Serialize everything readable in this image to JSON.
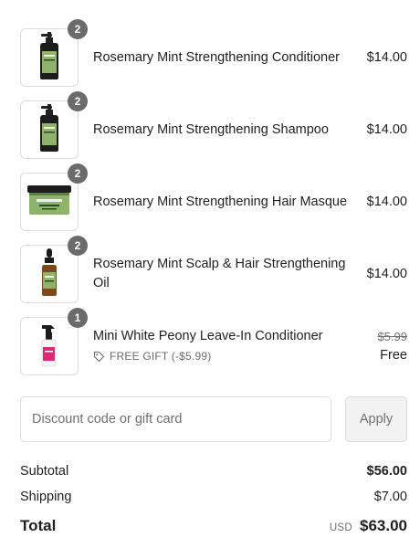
{
  "items": [
    {
      "quantity": "2",
      "name": "Rosemary Mint Strengthening Conditioner",
      "price": "$14.00",
      "image_icon": "pump-bottle-icon"
    },
    {
      "quantity": "2",
      "name": "Rosemary Mint Strengthening Shampoo",
      "price": "$14.00",
      "image_icon": "pump-bottle-icon"
    },
    {
      "quantity": "2",
      "name": "Rosemary Mint Strengthening Hair Masque",
      "price": "$14.00",
      "image_icon": "jar-icon"
    },
    {
      "quantity": "2",
      "name": "Rosemary Mint Scalp & Hair Strengthening Oil",
      "price": "$14.00",
      "image_icon": "dropper-bottle-icon"
    },
    {
      "quantity": "1",
      "name": "Mini White Peony Leave-In Conditioner",
      "gift_label": "FREE GIFT (-$5.99)",
      "original_price": "$5.99",
      "price": "Free",
      "image_icon": "spray-bottle-icon"
    }
  ],
  "discount": {
    "placeholder": "Discount code or gift card",
    "button_label": "Apply"
  },
  "summary": {
    "subtotal_label": "Subtotal",
    "subtotal_value": "$56.00",
    "shipping_label": "Shipping",
    "shipping_value": "$7.00",
    "total_label": "Total",
    "currency": "USD",
    "total_value": "$63.00"
  },
  "colors": {
    "badge": "#6b6b6b",
    "border": "#dcdcdc",
    "product_green": "#7fa35a",
    "gift_pink": "#e0287a"
  }
}
